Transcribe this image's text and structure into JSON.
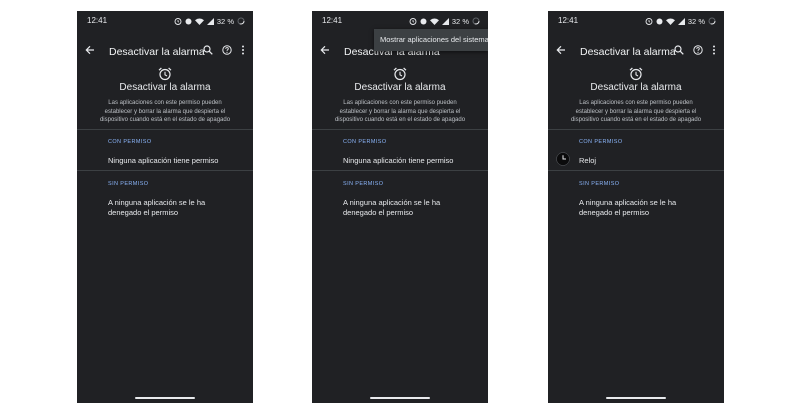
{
  "screens": [
    {
      "status": {
        "time": "12:41",
        "battery": "32 %"
      },
      "title": "Desactivar la alarma",
      "header_title": "Desactivar la alarma",
      "description": "Las aplicaciones con este permiso pueden establecer y borrar la alarma que despierta el dispositivo cuando está en el estado de apagado",
      "allowed_header": "CON PERMISO",
      "allowed_item": "Ninguna aplicación tiene permiso",
      "denied_header": "SIN PERMISO",
      "denied_item": "A ninguna aplicación se le ha denegado el permiso"
    },
    {
      "status": {
        "time": "12:41",
        "battery": "32 %"
      },
      "title": "Desactivar la alarma",
      "menu_item": "Mostrar aplicaciones del sistema",
      "header_title": "Desactivar la alarma",
      "description": "Las aplicaciones con este permiso pueden establecer y borrar la alarma que despierta el dispositivo cuando está en el estado de apagado",
      "allowed_header": "CON PERMISO",
      "allowed_item": "Ninguna aplicación tiene permiso",
      "denied_header": "SIN PERMISO",
      "denied_item": "A ninguna aplicación se le ha denegado el permiso"
    },
    {
      "status": {
        "time": "12:41",
        "battery": "32 %"
      },
      "title": "Desactivar la alarma",
      "header_title": "Desactivar la alarma",
      "description": "Las aplicaciones con este permiso pueden establecer y borrar la alarma que despierta el dispositivo cuando está en el estado de apagado",
      "allowed_header": "CON PERMISO",
      "allowed_item": "Reloj",
      "allowed_item_icon": "clock-app-icon",
      "denied_header": "SIN PERMISO",
      "denied_item": "A ninguna aplicación se le ha denegado el permiso"
    }
  ],
  "icons": [
    "back-arrow-icon",
    "search-icon",
    "help-icon",
    "more-vert-icon",
    "alarm-clock-icon",
    "clock-app-icon"
  ],
  "colors": {
    "background": "#202124",
    "accent": "#8ab4f8",
    "divider": "#3c4043",
    "text": "#e8eaed"
  }
}
